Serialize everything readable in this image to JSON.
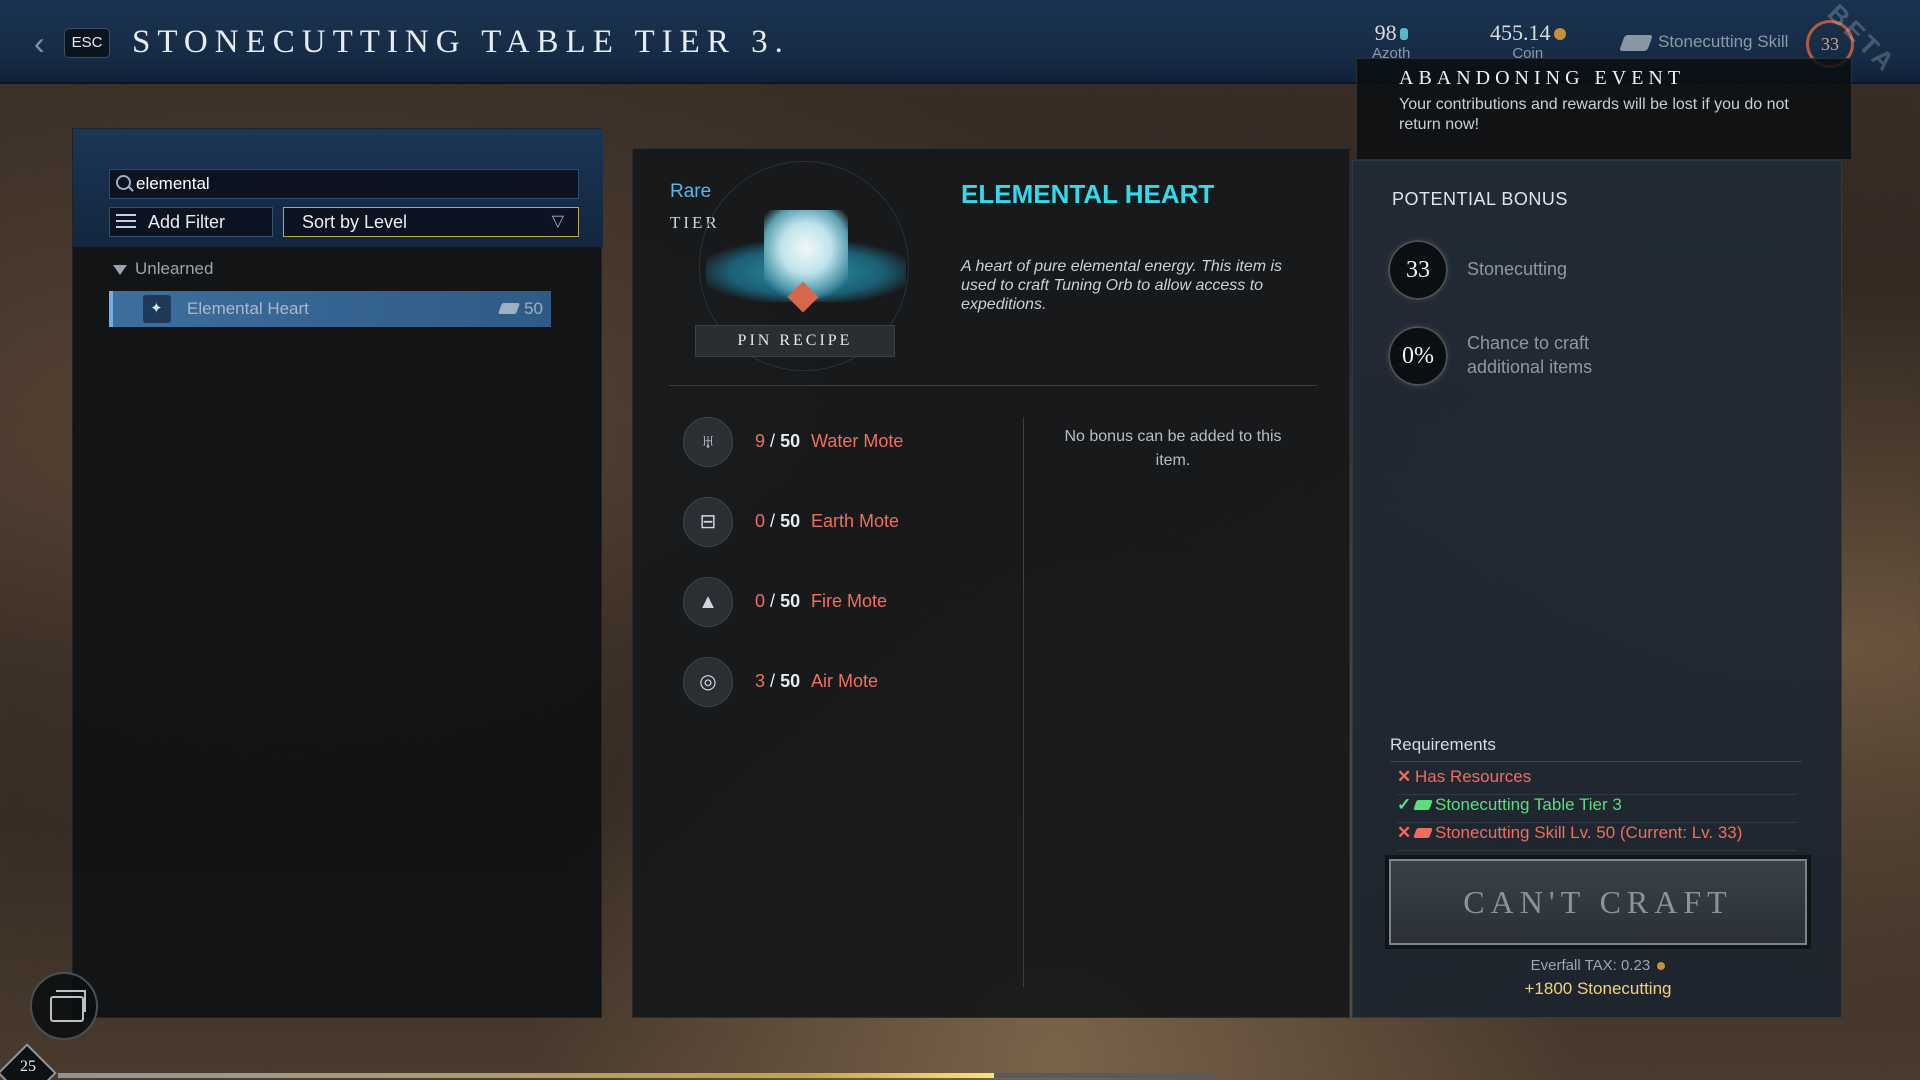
{
  "header": {
    "back_icon": "chevron-left-icon",
    "esc_label": "ESC",
    "title": "STONECUTTING TABLE TIER 3."
  },
  "currency": {
    "azoth_value": "98",
    "azoth_label": "Azoth",
    "coin_value": "455.14",
    "coin_label": "Coin",
    "skill_label": "Stonecutting Skill",
    "skill_level": "33"
  },
  "event": {
    "title": "ABANDONING EVENT",
    "text": "Your contributions and rewards will be lost if you do not return now!"
  },
  "watermark": "BETA",
  "left": {
    "search_value": "elemental",
    "add_filter_label": "Add Filter",
    "sort_label": "Sort by Level",
    "section_label": "Unlearned",
    "items": [
      {
        "name": "Elemental Heart",
        "level": "50"
      }
    ]
  },
  "recipe": {
    "rarity": "Rare",
    "tier_label": "TIER",
    "pin_label": "PIN RECIPE",
    "name": "ELEMENTAL HEART",
    "description": "A heart of pure elemental energy. This item is used to craft Tuning Orb to allow access to expeditions.",
    "no_bonus": "No bonus can be added to this item.",
    "ingredients": [
      {
        "have": "9",
        "sep": "/",
        "need": "50",
        "name": "Water Mote",
        "icon": "water-mote-icon",
        "glyph": "♅"
      },
      {
        "have": "0",
        "sep": "/",
        "need": "50",
        "name": "Earth Mote",
        "icon": "earth-mote-icon",
        "glyph": "⊟"
      },
      {
        "have": "0",
        "sep": "/",
        "need": "50",
        "name": "Fire Mote",
        "icon": "fire-mote-icon",
        "glyph": "▲"
      },
      {
        "have": "3",
        "sep": "/",
        "need": "50",
        "name": "Air Mote",
        "icon": "air-mote-icon",
        "glyph": "◎"
      }
    ]
  },
  "bonus": {
    "title": "POTENTIAL BONUS",
    "skill_value": "33",
    "skill_label": "Stonecutting",
    "chance_value": "0%",
    "chance_label": "Chance to craft additional items"
  },
  "requirements": {
    "title": "Requirements",
    "items": [
      {
        "mark": "✕",
        "text": "Has Resources",
        "met": false
      },
      {
        "mark": "✓",
        "text": "Stonecutting Table Tier 3",
        "met": true
      },
      {
        "mark": "✕",
        "text": "Stonecutting Skill Lv. 50 (Current: Lv. 33)",
        "met": false
      }
    ]
  },
  "craft": {
    "button_label": "CAN'T CRAFT",
    "tax_label": "Everfall TAX: 0.23",
    "xp_label": "+1800 Stonecutting"
  },
  "player": {
    "level": "25",
    "xp_progress": 0.81
  },
  "colors": {
    "rarity_blue": "#5bb7ee",
    "item_name_cyan": "#35d9ec",
    "missing_red": "#f06c5c",
    "met_green": "#5cde7c",
    "xp_gold": "#f0d37a"
  }
}
